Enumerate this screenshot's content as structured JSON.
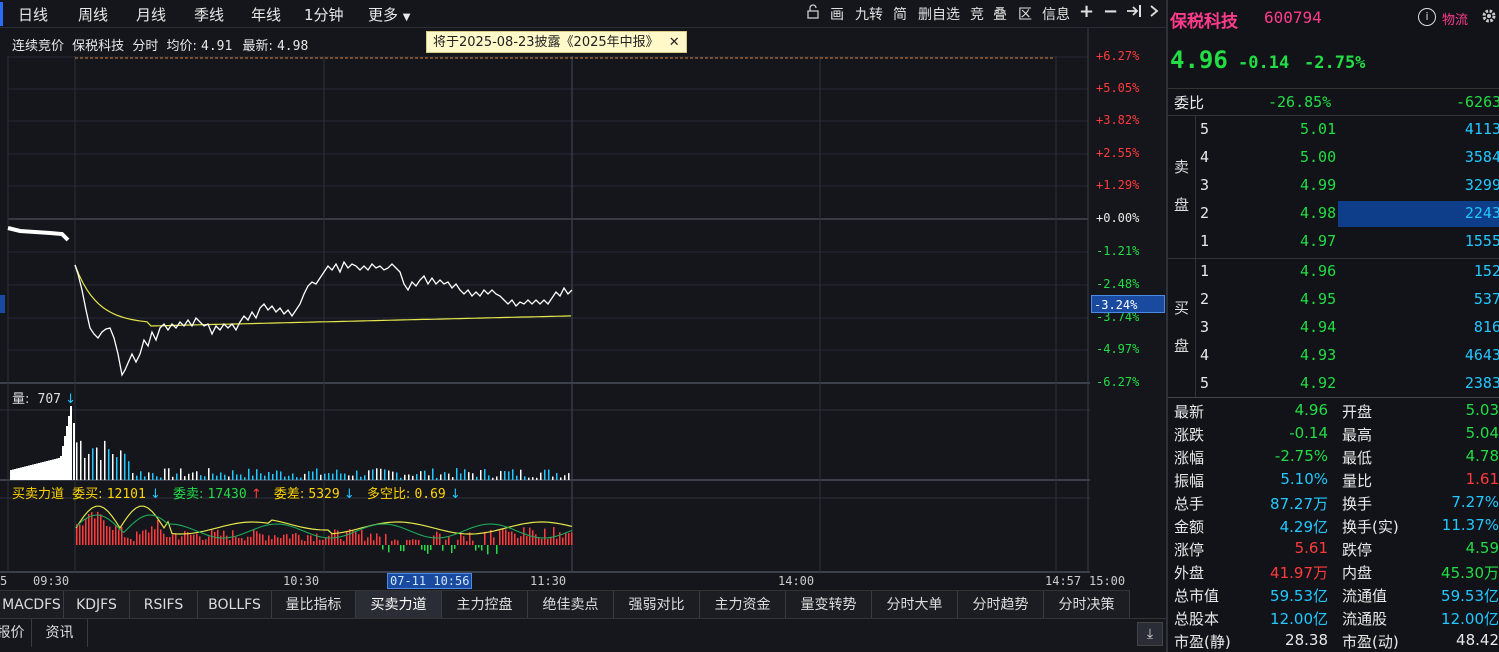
{
  "toolbar": {
    "periods": [
      "日线",
      "周线",
      "月线",
      "季线",
      "年线",
      "1分钟",
      "更多"
    ],
    "tools": [
      "画",
      "九转",
      "简",
      "删自选",
      "竞",
      "叠",
      "区",
      "信息"
    ]
  },
  "chart": {
    "header": {
      "mode": "连续竞价",
      "name": "保税科技",
      "type": "分时",
      "avg_label": "均价:",
      "avg_value": "4.91",
      "latest_label": "最新:",
      "latest_value": "4.98"
    },
    "notice": "将于2025-08-23披露《2025年中报》",
    "pct_ticks": [
      "+6.27%",
      "+5.05%",
      "+3.82%",
      "+2.55%",
      "+1.29%",
      "+0.00%",
      "-1.21%",
      "-2.48%",
      "-3.74%",
      "-4.97%",
      "-6.27%"
    ],
    "current_pct": "-3.24%",
    "volume_label": "量:",
    "volume_value": "707",
    "ind": {
      "name": "买卖力道",
      "buy_label": "委买:",
      "buy_value": "12101",
      "sell_label": "委卖:",
      "sell_value": "17430",
      "diff_label": "委差:",
      "diff_value": "5329",
      "ratio_label": "多空比:",
      "ratio_value": "0.69"
    },
    "time_axis": {
      "left_cut": "5",
      "t0930": "09:30",
      "t1030": "10:30",
      "cursor": "07-11 10:56",
      "t1130": "11:30",
      "t1400": "14:00",
      "t1457": "14:57",
      "t1500": "15:00"
    }
  },
  "tabs": [
    "MACDFS",
    "KDJFS",
    "RSIFS",
    "BOLLFS",
    "量比指标",
    "买卖力道",
    "主力控盘",
    "绝佳卖点",
    "强弱对比",
    "主力资金",
    "量变转势",
    "分时大单",
    "分时趋势",
    "分时决策"
  ],
  "tabs_active": "买卖力道",
  "tabs2": [
    "报价",
    "资讯"
  ],
  "panel": {
    "name": "保税科技",
    "code": "600794",
    "logistics": "物流",
    "price": "4.96",
    "change": "-0.14",
    "change_pct": "-2.75%",
    "weibi_label": "委比",
    "weibi_pct": "-26.85%",
    "weibi_diff": "-6263",
    "sell_label": [
      "卖",
      "盘"
    ],
    "buy_label": [
      "买",
      "盘"
    ],
    "asks": [
      {
        "level": "5",
        "price": "5.01",
        "vol": "4113"
      },
      {
        "level": "4",
        "price": "5.00",
        "vol": "3584"
      },
      {
        "level": "3",
        "price": "4.99",
        "vol": "3299"
      },
      {
        "level": "2",
        "price": "4.98",
        "vol": "2243"
      },
      {
        "level": "1",
        "price": "4.97",
        "vol": "1555"
      }
    ],
    "bids": [
      {
        "level": "1",
        "price": "4.96",
        "vol": "152"
      },
      {
        "level": "2",
        "price": "4.95",
        "vol": "537"
      },
      {
        "level": "3",
        "price": "4.94",
        "vol": "816"
      },
      {
        "level": "4",
        "price": "4.93",
        "vol": "4643"
      },
      {
        "level": "5",
        "price": "4.92",
        "vol": "2383"
      }
    ],
    "stats": [
      {
        "l": "最新",
        "v": "4.96",
        "lc": "green",
        "r": "开盘",
        "rv": "5.03",
        "rc": "green"
      },
      {
        "l": "涨跌",
        "v": "-0.14",
        "lc": "green",
        "r": "最高",
        "rv": "5.04",
        "rc": "green"
      },
      {
        "l": "涨幅",
        "v": "-2.75%",
        "lc": "green",
        "r": "最低",
        "rv": "4.78",
        "rc": "green"
      },
      {
        "l": "振幅",
        "v": "5.10%",
        "lc": "cyan",
        "r": "量比",
        "rv": "1.61",
        "rc": "red"
      },
      {
        "l": "总手",
        "v": "87.27万",
        "lc": "cyan",
        "r": "换手",
        "rv": "7.27%",
        "rc": "cyan"
      },
      {
        "l": "金额",
        "v": "4.29亿",
        "lc": "cyan",
        "r": "换手(实)",
        "rv": "11.37%",
        "rc": "cyan"
      },
      {
        "l": "涨停",
        "v": "5.61",
        "lc": "red",
        "r": "跌停",
        "rv": "4.59",
        "rc": "green"
      },
      {
        "l": "外盘",
        "v": "41.97万",
        "lc": "red",
        "r": "内盘",
        "rv": "45.30万",
        "rc": "green"
      },
      {
        "l": "总市值",
        "v": "59.53亿",
        "lc": "cyan",
        "r": "流通值",
        "rv": "59.53亿",
        "rc": "cyan"
      },
      {
        "l": "总股本",
        "v": "12.00亿",
        "lc": "cyan",
        "r": "流通股",
        "rv": "12.00亿",
        "rc": "cyan"
      },
      {
        "l": "市盈(静)",
        "v": "28.38",
        "lc": "white",
        "r": "市盈(动)",
        "rv": "48.42",
        "rc": "white"
      }
    ]
  },
  "colors": {
    "up": "#ff3b3b",
    "down": "#22dd44",
    "price_line": "#ffffff",
    "avg_line": "#e6e64a",
    "volume": "#22c8ff",
    "panel_name": "#ff3b8b"
  }
}
